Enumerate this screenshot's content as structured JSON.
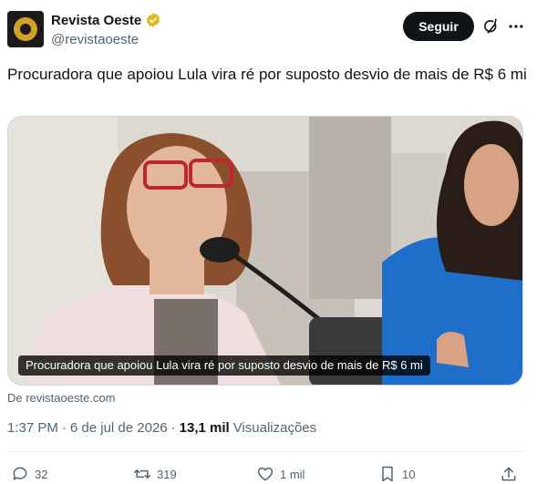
{
  "author": {
    "name": "Revista Oeste",
    "handle": "@revistaoeste",
    "verified_color": "#e2b719"
  },
  "header": {
    "follow_label": "Seguir",
    "icons": [
      "grok-icon",
      "more-icon"
    ]
  },
  "tweet": {
    "text": "Procuradora que apoiou Lula vira ré por suposto desvio de mais de R$ 6 mi",
    "media_caption": "Procuradora que apoiou Lula vira ré por suposto desvio de mais de R$ 6 mi",
    "source": "De revistaoeste.com"
  },
  "meta": {
    "time": "1:37 PM",
    "separator": "·",
    "date": "6 de jul de 2026",
    "views_count": "13,1 mil",
    "views_label": "Visualizações"
  },
  "actions": {
    "replies": "32",
    "reposts": "319",
    "likes": "1 mil",
    "bookmarks": "10"
  },
  "colors": {
    "text_primary": "#0f1419",
    "text_secondary": "#536471",
    "button_bg": "#0f1419",
    "border": "#cfd9de"
  }
}
